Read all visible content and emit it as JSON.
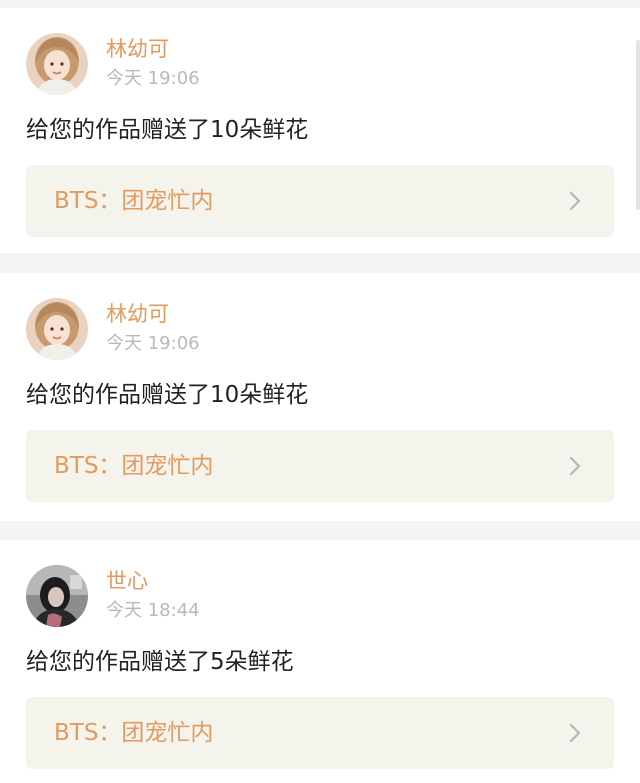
{
  "notifications": [
    {
      "user_name": "林幼可",
      "time": "今天 19:06",
      "message": "给您的作品赠送了10朵鲜花",
      "work_title": "BTS：团宠忙内",
      "avatar_icon": "user-avatar-icon"
    },
    {
      "user_name": "林幼可",
      "time": "今天 19:06",
      "message": "给您的作品赠送了10朵鲜花",
      "work_title": "BTS：团宠忙内",
      "avatar_icon": "user-avatar-icon"
    },
    {
      "user_name": "世心",
      "time": "今天 18:44",
      "message": "给您的作品赠送了5朵鲜花",
      "work_title": "BTS：团宠忙内",
      "avatar_icon": "user-avatar-icon"
    }
  ],
  "colors": {
    "accent": "#e39a5e",
    "muted_text": "#b9b9b9",
    "body_text": "#222222",
    "link_background": "#f4f3ec",
    "page_background": "#f5f4f2"
  }
}
